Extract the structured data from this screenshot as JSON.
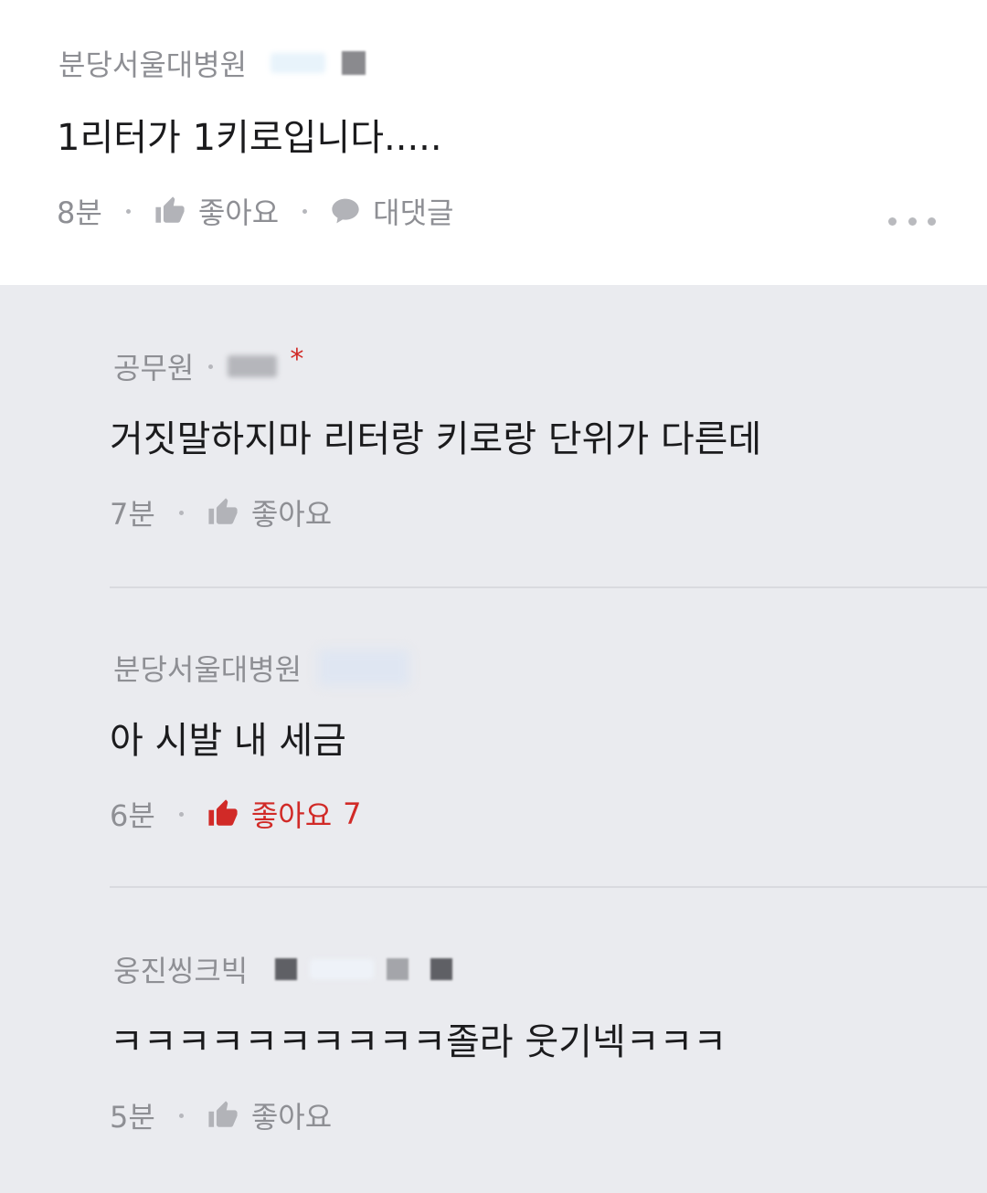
{
  "colors": {
    "reply_background": "#eaebef",
    "liked_red": "#d12a27",
    "meta_gray": "#8e8f94"
  },
  "main_comment": {
    "author": "분당서울대병원",
    "text": "1리터가 1키로입니다.....",
    "time": "8분",
    "like_label": "좋아요",
    "reply_label": "대댓글",
    "like_icon": "thumbs-up-icon",
    "reply_icon": "speech-bubble-icon",
    "more_icon": "more-dots-icon"
  },
  "replies": [
    {
      "author": "공무원",
      "star": "*",
      "text": "거짓말하지마 리터랑 키로랑 단위가 다른데",
      "time": "7분",
      "like_label": "좋아요",
      "like_count": "",
      "liked": false
    },
    {
      "author": "분당서울대병원",
      "text": "아 시발 내 세금",
      "time": "6분",
      "like_label": "좋아요",
      "like_count": "7",
      "liked": true
    },
    {
      "author": "웅진씽크빅",
      "text": "ㅋㅋㅋㅋㅋㅋㅋㅋㅋㅋ졸라 웃기넥ㅋㅋㅋ",
      "time": "5분",
      "like_label": "좋아요",
      "like_count": "",
      "liked": false
    }
  ]
}
